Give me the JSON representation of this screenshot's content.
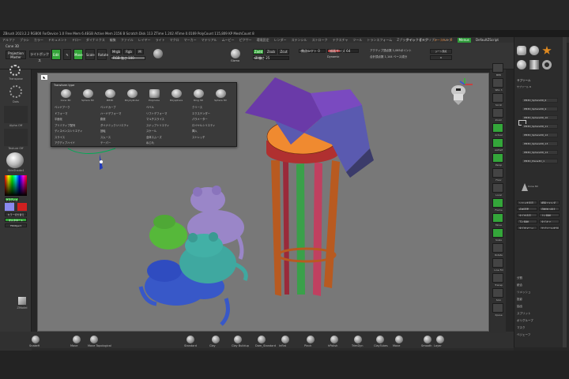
{
  "app": {
    "title_bar": "ZBrush 2023.2.2   RGB00 ForDevice 1.0   Free Mem 6.4EGB   Active Mem 2156 B   Scratch Disk 113   ZTime 1.202 ATime 0.0169   PolyCount 115,809 KP   MeshCount 8",
    "menu": [
      "アルファ",
      "ブラシ",
      "カラー",
      "ドキュメント",
      "ドロー",
      "ダイナミクス",
      "編集",
      "ファイル",
      "レイヤー",
      "ライト",
      "マクロ",
      "マーカー",
      "マテリアル",
      "ムービー",
      "ピクサー",
      "環境設定",
      "レンダー",
      "ステンシル",
      "ストローク",
      "テクスチャ",
      "ツール",
      "トランスフォーム",
      "Zプラグイン",
      "Zスクリプト",
      "ヘルプ"
    ],
    "menu_right": {
      "quicksave": "クイックセーブ",
      "seethrough": "シースルー  0",
      "menus": "Menus",
      "script": "DefaultZScript"
    }
  },
  "toolbar": {
    "tool_name": "Cone 3D",
    "projection_master": "Projection Master",
    "lightbox": "ライトボックス",
    "edit": "Edit",
    "draw": "Draw",
    "move": "Move",
    "scale": "Scale",
    "rotate": "Rotate",
    "mrgb": "Mrgb",
    "rgb": "Rgb",
    "m": "M",
    "zadd": "Zadd",
    "zsub": "Zsub",
    "zcut": "Zcut",
    "rgb_intensity": "RGB 強さ 100",
    "z_intensity": "Z 強さ 25",
    "focal_shift": "焦点シフト 0",
    "draw_size": "描画サイズ 64",
    "dynamic": "Dynamic",
    "active_points": "アクティブ頂点数 1,065ポイント",
    "total_points": "合計頂点数 1,144 ベース成分",
    "zero": "0",
    "symmetry_label": "Gizmo",
    "seethrough": "ジーン頂点"
  },
  "left": {
    "transpose": "Transpose",
    "dots": "Dots",
    "alpha_off": "Alpha Off",
    "texture_off": "Texture Off",
    "material": "SkinShade4",
    "gradient": "グラディエント",
    "switch_color": "カラー切り替え",
    "alternate": "オルタネート",
    "fill_object": "FillObject",
    "zmodel": "ZModel"
  },
  "popup": {
    "title": "Transform type",
    "shapes": [
      "Cone 3D",
      "Sphere 3D",
      "PM3D",
      "PolyCylinder",
      "PolyCube",
      "Polysphere",
      "Ring 3D",
      "Sphere 3D"
    ],
    "items": [
      [
        "ベンドアーク",
        "ベンドカーブ",
        "ベベル",
        "クリース"
      ],
      [
        "ドフォーマ",
        "ハードデフォーマ",
        "リフトデフォーマ",
        "エクステンダー"
      ],
      [
        "平面化",
        "膨張",
        "マルチスライス",
        "パラメーター"
      ],
      [
        "プリミティブ配列",
        "ダイナミックシリエティ",
        "スナップトリエティ",
        "ロイヤルシリエティ"
      ],
      [
        "ディスペンスシリエティ",
        "回転",
        "スケール",
        "挿入"
      ],
      [
        "スライス",
        "スムース",
        "全体スムーズ",
        "ストレッチ"
      ],
      [
        "アグディブハイド",
        "テーパー",
        "ねじれ",
        ""
      ]
    ]
  },
  "bottom_brushes": [
    "SnakeH",
    "Move",
    "Move Topological",
    "Standard",
    "Clay",
    "Clay Buildup",
    "Dam_Standard",
    "Inflat",
    "Pinch",
    "hPolish",
    "TrimDyn",
    "ClayTubes",
    "Move",
    "Smooth",
    "Layer",
    "ZProject",
    "Slash3",
    "SliceCurve"
  ],
  "right_strip": [
    "BPR",
    "SPix 3",
    "Scroll",
    "Zoom",
    "Actual",
    "AAHalf",
    "Persp",
    "Floor",
    "Local",
    "Frame",
    "Move",
    "Scale",
    "Rotate",
    "Line Fill",
    "Transp",
    "Solo",
    "Xpose"
  ],
  "subtool": {
    "header": "サブツール",
    "count": "サブツール 8",
    "list": [
      "PM3D_Sphere3D_6",
      "PM3D_Sphere3D_9",
      "PM3D_Sphere3D_10",
      "PM3D_Sphere3D_11",
      "PM3D_Sphere3D_12",
      "PM3D_Sphere3D_13",
      "PM3D_Sphere3D_14",
      "PM3D_Plane3D_1"
    ],
    "buttons": [
      "リストを表示",
      "複製フォルダ",
      "名前変更",
      "自動並べ替え",
      "全てを表示",
      "上に移動",
      "下に移動",
      "全てオフ",
      "全てをマージ",
      "サブツールを分割"
    ],
    "sections": [
      "分割",
      "統合",
      "リメッシュ",
      "投影",
      "抽出",
      "スプリット",
      "ポリグループ",
      "マスク",
      "ベジェーフ"
    ],
    "tool_label": "Cone 3D"
  },
  "colors": {
    "accent_green": "#34a63a",
    "viewport_bg": "#787878",
    "panel": "#353535",
    "accent_orange": "#e07a2a"
  }
}
